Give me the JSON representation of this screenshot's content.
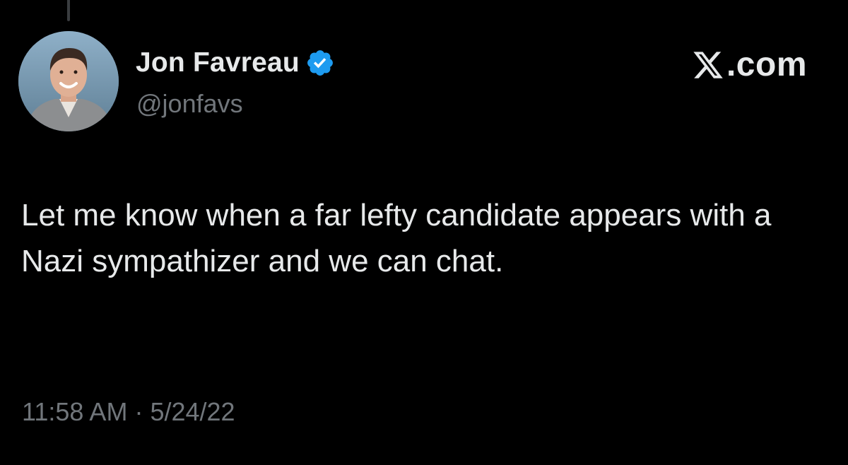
{
  "author": {
    "display_name": "Jon Favreau",
    "handle": "@jonfavs",
    "verified": true,
    "verified_icon": "verified-badge-icon",
    "avatar_icon": "profile-photo"
  },
  "brand": {
    "icon": "x-logo-icon",
    "text": ".com"
  },
  "tweet": {
    "text": "Let me know when a far lefty candidate appears with a Nazi sympathizer and we can chat.",
    "time": "11:58 AM",
    "separator": "·",
    "date": "5/24/22"
  },
  "colors": {
    "background": "#000000",
    "primary_text": "#e7e9ea",
    "secondary_text": "#71767b",
    "verified_blue": "#1d9bf0"
  }
}
